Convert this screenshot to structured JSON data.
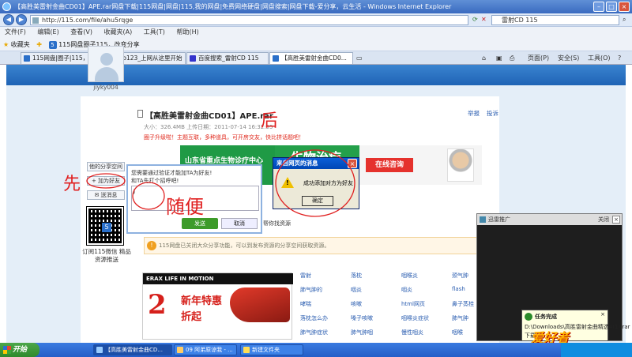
{
  "window": {
    "title": "【高胜美雷射金曲CD01】APE.rar网盘下载|115网盘|网盘|115,我的网盘|免费网络硬盘|网盘搜索|网盘下载-爱分享，云生活 - Windows Internet Explorer"
  },
  "address": {
    "url": "http://115.com/file/ahu5rqge",
    "search_value": "雷射CD 115"
  },
  "menu": [
    "文件(F)",
    "编辑(E)",
    "查看(V)",
    "收藏夹(A)",
    "工具(T)",
    "帮助(H)"
  ],
  "favorites": {
    "label": "收藏夹",
    "item": "115网盘圈子115，改变分享"
  },
  "tabs": [
    {
      "label": "115网盘|圈子|115，改变..."
    },
    {
      "label": "hao123_上网从这里开始"
    },
    {
      "label": "百度搜索_雷射CD 115"
    },
    {
      "label": "【高胜美雷射金曲CD0..."
    }
  ],
  "commandbar": {
    "page": "页面(P)",
    "safety": "安全(S)",
    "tools": "工具(O)"
  },
  "sidebar": {
    "username": "jiyky004",
    "btn_share": "他的分享空间",
    "btn_follow": "+ 加为好友",
    "btn_chat": "✉ 送消息",
    "qr_caption": "订阅115微信 精品资源推送"
  },
  "file": {
    "title": "【高胜美雷射金曲CD01】APE.rar",
    "meta": "大小：326.4MB    上传日期：2011-07-14 16:32:55",
    "notice_red": "圈子升级啦！主题互联，多种道具，可开房交友，快比拼话题吧！",
    "link_report": "举报",
    "link_complaint": "投诉",
    "related": "帮你找资源",
    "notice": "115网盘已关闭大众分享功能，可以到发布资源的分享空间获取资源。"
  },
  "ad": {
    "hospital": "山东省重点生物诊疗中心",
    "bio": "生物治疗",
    "consult": "在线咨询"
  },
  "follow_dialog": {
    "line1": "您需要通过验证才能加TA为好友!",
    "line2": "和TA先打个招呼吧!",
    "input": "J",
    "send": "发送",
    "cancel": "取消"
  },
  "alert": {
    "caption": "来自网页的消息",
    "message": "成功添加对方为好友",
    "ok": "确定"
  },
  "shoe_ad": {
    "brand": "ERAX  LIFE IN MOTION",
    "big": "2",
    "line1": "新年特惠",
    "line2": "折起"
  },
  "links": [
    [
      "雷射",
      "落枕",
      "咽喉炎",
      "颈气肿"
    ],
    [
      "肺气肿的",
      "咽炎",
      "咽炎",
      "flash"
    ],
    [
      "哮喘",
      "咳嗽",
      "html网页",
      "鼻子蒸桂"
    ],
    [
      "落枕怎么办",
      "嗓子咳嗽",
      "咽喉炎症状",
      "肺气肿"
    ],
    [
      "肺气肿症状",
      "肺气肿咽",
      "慢性咽炎",
      "咽喉"
    ]
  ],
  "popup": {
    "title": "迅雷推广",
    "close": "关闭",
    "task_title": "任务完成",
    "task_file": "D:\\Downloads\\高胜雷射金曲精选4(1).rar",
    "task_sub": "下载"
  },
  "brand_watermark": "爱好者",
  "taskbar": {
    "start": "开始",
    "items": [
      "【高胜美雷射金曲CD...",
      "09 阿弟原谅我 - ...",
      "新建文件夹"
    ]
  },
  "handwriting": {
    "left": "先",
    "middle": "随便",
    "top": "后"
  }
}
